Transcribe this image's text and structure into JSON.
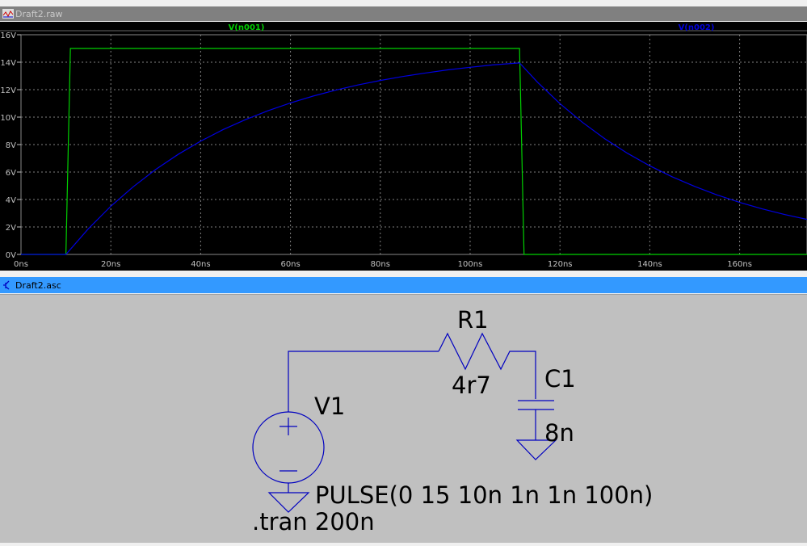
{
  "plot_window": {
    "title": "Draft2.raw"
  },
  "schematic_window": {
    "title": "Draft2.asc"
  },
  "colors": {
    "trace1": "#00d000",
    "trace2": "#0000e0",
    "grid": "#808080",
    "wire": "#0000c0",
    "schematic_bg": "#c0c0c0",
    "plot_bg": "#000000",
    "asc_titlebar": "#3399ff"
  },
  "chart_data": {
    "type": "line",
    "xlabel": "",
    "ylabel": "",
    "xlim": [
      0,
      175
    ],
    "ylim": [
      0,
      16
    ],
    "x_ticks": [
      0,
      20,
      40,
      60,
      80,
      100,
      120,
      140,
      160
    ],
    "x_tick_labels": [
      "0ns",
      "20ns",
      "40ns",
      "60ns",
      "80ns",
      "100ns",
      "120ns",
      "140ns",
      "160ns"
    ],
    "y_ticks": [
      0,
      2,
      4,
      6,
      8,
      10,
      12,
      14,
      16
    ],
    "y_tick_labels": [
      "0V",
      "2V",
      "4V",
      "6V",
      "8V",
      "10V",
      "12V",
      "14V",
      "16V"
    ],
    "grid": true,
    "series": [
      {
        "name": "V(n001)",
        "x": [
          0,
          10,
          11,
          111,
          112,
          175
        ],
        "y": [
          0,
          0,
          15,
          15,
          0,
          0
        ]
      },
      {
        "name": "V(n002)",
        "x": [
          0,
          10,
          15,
          20,
          25,
          30,
          35,
          40,
          45,
          50,
          55,
          60,
          65,
          70,
          75,
          80,
          85,
          90,
          95,
          100,
          105,
          111,
          115,
          120,
          125,
          130,
          135,
          140,
          145,
          150,
          155,
          160,
          165,
          170,
          175
        ],
        "y": [
          0,
          0,
          1.87,
          3.51,
          4.93,
          6.19,
          7.29,
          8.25,
          9.09,
          9.82,
          10.47,
          11.03,
          11.53,
          11.96,
          12.34,
          12.67,
          12.96,
          13.21,
          13.44,
          13.63,
          13.8,
          13.95,
          12.54,
          10.98,
          9.62,
          8.42,
          7.37,
          6.45,
          5.65,
          4.95,
          4.33,
          3.79,
          3.32,
          2.91,
          2.55
        ]
      }
    ]
  },
  "schematic": {
    "v1_name": "V1",
    "v1_value": "PULSE(0 15 10n 1n 1n 100n)",
    "r1_name": "R1",
    "r1_value": "4r7",
    "c1_name": "C1",
    "c1_value": "8n",
    "directive": ".tran 200n"
  }
}
